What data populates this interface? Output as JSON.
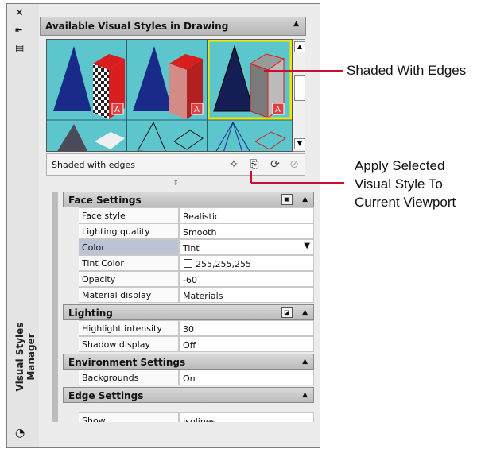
{
  "palette": {
    "vertical_title": "Visual Styles Manager",
    "icons": [
      "close-icon",
      "autohide-icon",
      "properties-icon",
      "visual-styles-icon"
    ]
  },
  "gallery": {
    "title": "Available Visual Styles in Drawing",
    "status": "Shaded with edges"
  },
  "sections": [
    {
      "title": "Face Settings",
      "rows": [
        {
          "label": "Face style",
          "value": "Realistic"
        },
        {
          "label": "Lighting quality",
          "value": "Smooth"
        },
        {
          "label": "Color",
          "value": "Tint"
        },
        {
          "label": "Tint Color",
          "value": "255,255,255"
        },
        {
          "label": "Opacity",
          "value": "-60"
        },
        {
          "label": "Material display",
          "value": "Materials"
        }
      ]
    },
    {
      "title": "Lighting",
      "rows": [
        {
          "label": "Highlight intensity",
          "value": "30"
        },
        {
          "label": "Shadow display",
          "value": "Off"
        }
      ]
    },
    {
      "title": "Environment Settings",
      "rows": [
        {
          "label": "Backgrounds",
          "value": "On"
        }
      ]
    },
    {
      "title": "Edge Settings",
      "rows": [
        {
          "label": "Show",
          "value": "Isolines"
        }
      ]
    }
  ],
  "callouts": {
    "shaded": "Shaded With Edges",
    "apply_line1": "Apply Selected",
    "apply_line2": "Visual Style To",
    "apply_line3": "Current Viewport"
  },
  "colors": {
    "thumb_bg": "#5cc6cc",
    "selected_border": "#f2e600",
    "callout_line": "#c8102e"
  }
}
